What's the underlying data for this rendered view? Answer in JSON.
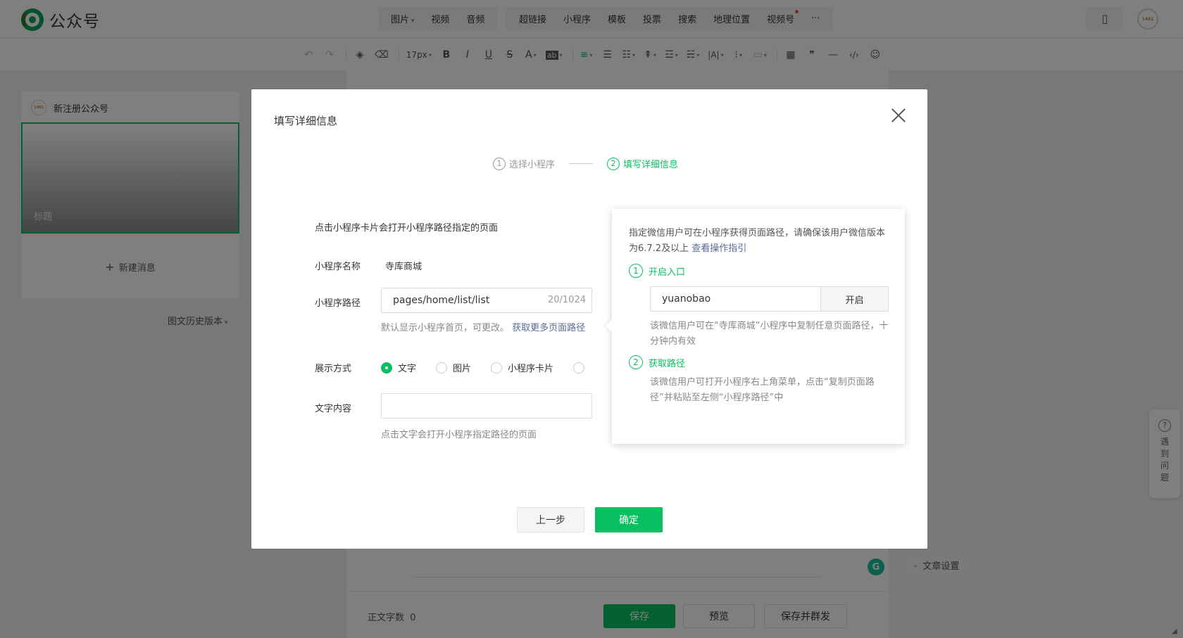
{
  "app": {
    "logo_text": "公众号"
  },
  "header": {
    "group1": [
      "图片",
      "视频",
      "音频"
    ],
    "group2": [
      "超链接",
      "小程序",
      "模板",
      "投票",
      "搜索",
      "地理位置",
      "视频号",
      "···"
    ],
    "avatar_text": "1481"
  },
  "toolbar": {
    "font_size": "17px",
    "bold": "B",
    "italic": "I",
    "underline": "U",
    "strike": "S",
    "font_color": "A",
    "bg_color": "ab",
    "letter_spacing": "|A|",
    "quote": "❞",
    "code": "‹/›"
  },
  "left_panel": {
    "account_name": "新注册公众号",
    "account_avatar_text": "1481",
    "cover_title_placeholder": "标题",
    "new_message": "新建消息",
    "history": "图文历史版本"
  },
  "bottom": {
    "word_count_label": "正文字数",
    "word_count": "0",
    "save": "保存",
    "preview": "预览",
    "save_send": "保存并群发",
    "article_settings": "文章设置"
  },
  "help_float": {
    "text": "遇到问题"
  },
  "dialog": {
    "title": "填写详细信息",
    "steps": [
      {
        "num": "1",
        "label": "选择小程序"
      },
      {
        "num": "2",
        "label": "填写详细信息"
      }
    ],
    "hint": "点击小程序卡片会打开小程序路径指定的页面",
    "name_label": "小程序名称",
    "name_value": "寺库商城",
    "path_label": "小程序路径",
    "path_value": "pages/home/list/list",
    "path_count": "20/1024",
    "path_desc": "默认显示小程序首页，可更改。",
    "path_link": "获取更多页面路径",
    "display_label": "展示方式",
    "display_options": [
      "文字",
      "图片",
      "小程序卡片"
    ],
    "text_label": "文字内容",
    "text_value": "",
    "text_desc": "点击文字会打开小程序指定路径的页面",
    "btn_prev": "上一步",
    "btn_ok": "确定"
  },
  "popover": {
    "intro": "指定微信用户可在小程序获得页面路径，请确保该用户微信版本为6.7.2及以上",
    "intro_link": "查看操作指引",
    "step1_num": "1",
    "step1_title": "开启入口",
    "input_value": "yuanobao",
    "open_btn": "开启",
    "step1_desc": "该微信用户可在“寺库商城”小程序中复制任意页面路径，十分钟内有效",
    "step2_num": "2",
    "step2_title": "获取路径",
    "step2_desc": "该微信用户可打开小程序右上角菜单，点击“复制页面路径”并粘贴至左侧“小程序路径”中"
  },
  "colors": {
    "brand_green": "#07c160",
    "link_blue": "#576b95",
    "overlay": "rgba(0,0,0,0.5)"
  }
}
